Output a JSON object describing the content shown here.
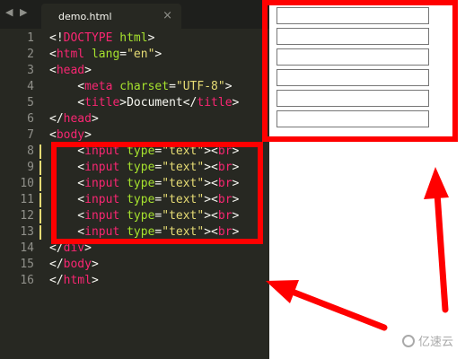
{
  "tabbar": {
    "nav_arrows": "◀ ▶",
    "active_tab": {
      "title": "demo.html",
      "close_glyph": "×"
    }
  },
  "code_lines": [
    {
      "num": "1",
      "tokens": [
        [
          "punc",
          "<!"
        ],
        [
          "doctype-kw",
          "DOCTYPE"
        ],
        [
          "punc",
          " "
        ],
        [
          "attr",
          "html"
        ],
        [
          "punc",
          ">"
        ]
      ]
    },
    {
      "num": "2",
      "tokens": [
        [
          "punc",
          "<"
        ],
        [
          "tag",
          "html"
        ],
        [
          "punc",
          " "
        ],
        [
          "attr",
          "lang"
        ],
        [
          "punc",
          "="
        ],
        [
          "str",
          "\"en\""
        ],
        [
          "punc",
          ">"
        ]
      ]
    },
    {
      "num": "3",
      "tokens": [
        [
          "punc",
          "<"
        ],
        [
          "tag",
          "head"
        ],
        [
          "punc",
          ">"
        ]
      ]
    },
    {
      "num": "4",
      "tokens": [
        [
          "punc",
          "    <"
        ],
        [
          "tag",
          "meta"
        ],
        [
          "punc",
          " "
        ],
        [
          "attr",
          "charset"
        ],
        [
          "punc",
          "="
        ],
        [
          "str",
          "\"UTF-8\""
        ],
        [
          "punc",
          ">"
        ]
      ]
    },
    {
      "num": "5",
      "tokens": [
        [
          "punc",
          "    <"
        ],
        [
          "tag",
          "title"
        ],
        [
          "punc",
          ">"
        ],
        [
          "txt",
          "Document"
        ],
        [
          "punc",
          "</"
        ],
        [
          "tag",
          "title"
        ],
        [
          "punc",
          ">"
        ]
      ]
    },
    {
      "num": "6",
      "tokens": [
        [
          "punc",
          "</"
        ],
        [
          "tag",
          "head"
        ],
        [
          "punc",
          ">"
        ]
      ]
    },
    {
      "num": "7",
      "tokens": [
        [
          "punc",
          "<"
        ],
        [
          "tag",
          "body"
        ],
        [
          "punc",
          ">"
        ]
      ]
    },
    {
      "num": "8",
      "modified": true,
      "tokens": [
        [
          "punc",
          "    <"
        ],
        [
          "tag",
          "input"
        ],
        [
          "punc",
          " "
        ],
        [
          "attr",
          "type"
        ],
        [
          "punc",
          "="
        ],
        [
          "str",
          "\"text\""
        ],
        [
          "punc",
          "><"
        ],
        [
          "tag",
          "br"
        ],
        [
          "punc",
          ">"
        ]
      ]
    },
    {
      "num": "9",
      "modified": true,
      "tokens": [
        [
          "punc",
          "    <"
        ],
        [
          "tag",
          "input"
        ],
        [
          "punc",
          " "
        ],
        [
          "attr",
          "type"
        ],
        [
          "punc",
          "="
        ],
        [
          "str",
          "\"text\""
        ],
        [
          "punc",
          "><"
        ],
        [
          "tag",
          "br"
        ],
        [
          "punc",
          ">"
        ]
      ]
    },
    {
      "num": "10",
      "modified": true,
      "tokens": [
        [
          "punc",
          "    <"
        ],
        [
          "tag",
          "input"
        ],
        [
          "punc",
          " "
        ],
        [
          "attr",
          "type"
        ],
        [
          "punc",
          "="
        ],
        [
          "str",
          "\"text\""
        ],
        [
          "punc",
          "><"
        ],
        [
          "tag",
          "br"
        ],
        [
          "punc",
          ">"
        ]
      ]
    },
    {
      "num": "11",
      "modified": true,
      "tokens": [
        [
          "punc",
          "    <"
        ],
        [
          "tag",
          "input"
        ],
        [
          "punc",
          " "
        ],
        [
          "attr",
          "type"
        ],
        [
          "punc",
          "="
        ],
        [
          "str",
          "\"text\""
        ],
        [
          "punc",
          "><"
        ],
        [
          "tag",
          "br"
        ],
        [
          "punc",
          ">"
        ]
      ]
    },
    {
      "num": "12",
      "modified": true,
      "tokens": [
        [
          "punc",
          "    <"
        ],
        [
          "tag",
          "input"
        ],
        [
          "punc",
          " "
        ],
        [
          "attr",
          "type"
        ],
        [
          "punc",
          "="
        ],
        [
          "str",
          "\"text\""
        ],
        [
          "punc",
          "><"
        ],
        [
          "tag",
          "br"
        ],
        [
          "punc",
          ">"
        ]
      ]
    },
    {
      "num": "13",
      "modified": true,
      "tokens": [
        [
          "punc",
          "    <"
        ],
        [
          "tag",
          "input"
        ],
        [
          "punc",
          " "
        ],
        [
          "attr",
          "type"
        ],
        [
          "punc",
          "="
        ],
        [
          "str",
          "\"text\""
        ],
        [
          "punc",
          "><"
        ],
        [
          "tag",
          "br"
        ],
        [
          "punc",
          ">"
        ]
      ]
    },
    {
      "num": "14",
      "tokens": [
        [
          "punc",
          "</"
        ],
        [
          "tag",
          "div"
        ],
        [
          "punc",
          ">"
        ]
      ]
    },
    {
      "num": "15",
      "tokens": [
        [
          "punc",
          "</"
        ],
        [
          "tag",
          "body"
        ],
        [
          "punc",
          ">"
        ]
      ]
    },
    {
      "num": "16",
      "tokens": [
        [
          "punc",
          "</"
        ],
        [
          "tag",
          "html"
        ],
        [
          "punc",
          ">"
        ]
      ]
    }
  ],
  "preview": {
    "text_input_count": 6
  },
  "colors": {
    "editor_bg": "#272822",
    "tab_bar_bg": "#1e1f1c",
    "tag": "#f92672",
    "attribute": "#a6e22e",
    "string": "#e6db74",
    "text": "#f8f8f2",
    "line_number": "#90908a",
    "modified_marker": "#e6db74",
    "annotation": "#ff0000"
  },
  "watermark": {
    "text": "亿速云",
    "logo_icon": "cloud-logo-icon"
  }
}
